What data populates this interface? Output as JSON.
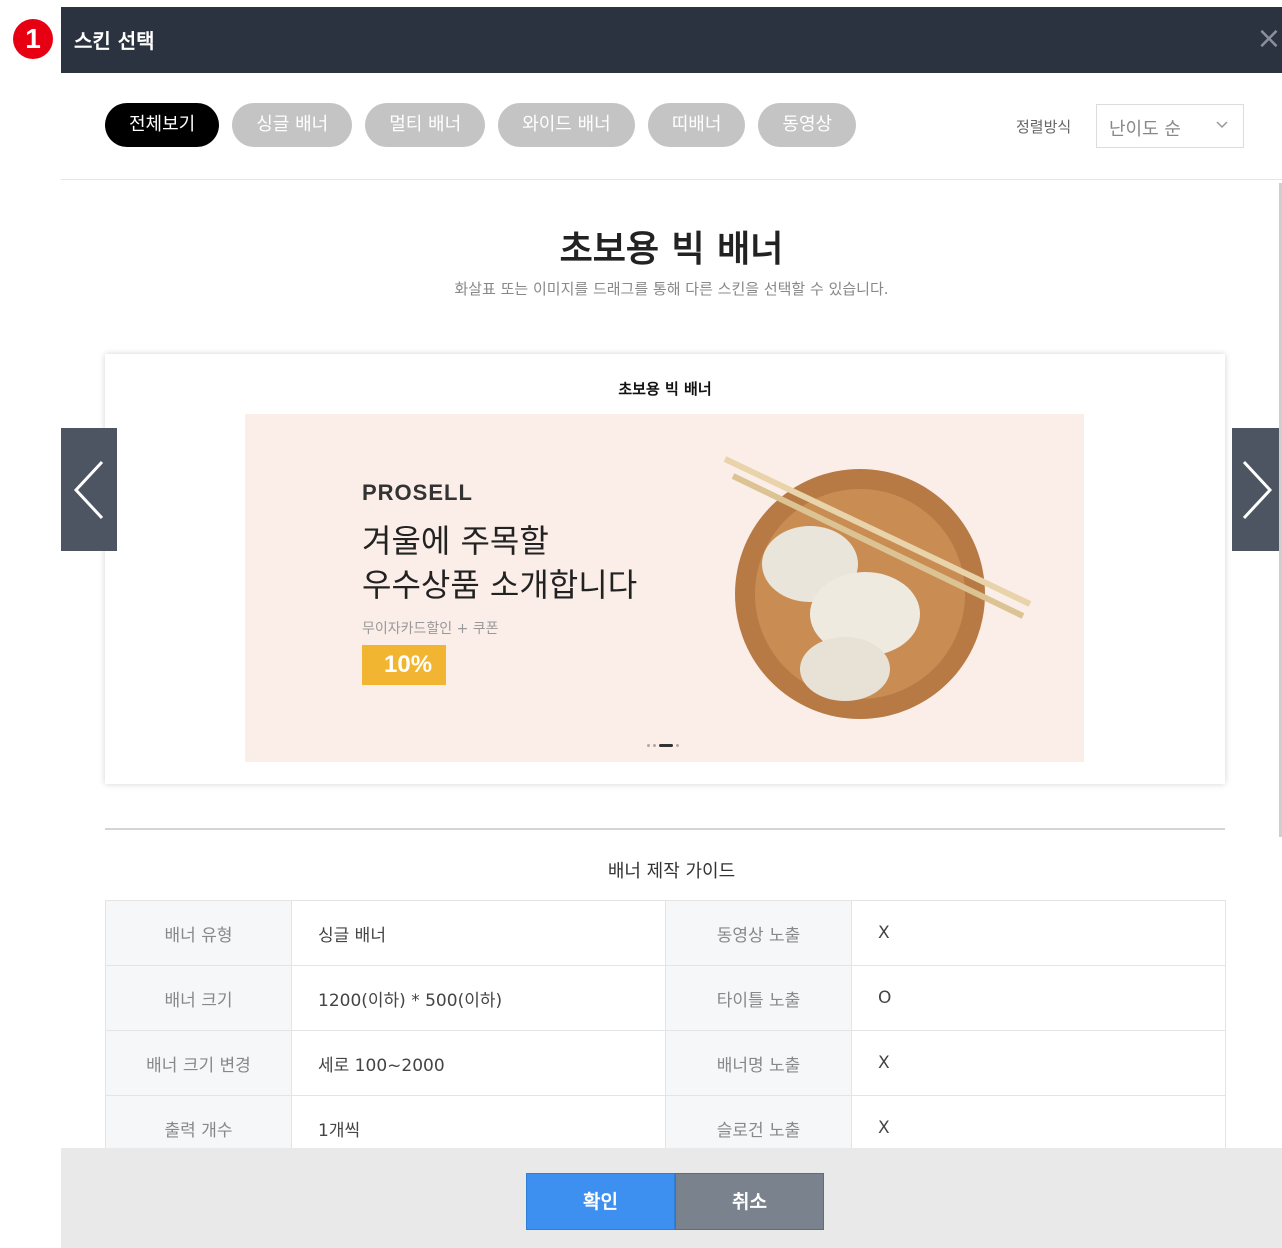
{
  "badge": "1",
  "modal": {
    "title": "스킨 선택",
    "close_symbol": "×"
  },
  "filters": {
    "tabs": [
      "전체보기",
      "싱글 배너",
      "멀티 배너",
      "와이드 배너",
      "띠배너",
      "동영상"
    ],
    "active_tab": "전체보기",
    "sort_label": "정렬방식",
    "sort_value": "난이도 순"
  },
  "skin": {
    "title": "초보용 빅 배너",
    "description": "화살표 또는 이미지를 드래그를 통해 다른 스킨을 선택할 수 있습니다.",
    "preview_title": "초보용 빅 배너"
  },
  "banner": {
    "brand": "PROSELL",
    "headline_line1": "겨울에 주목할",
    "headline_line2": "우수상품 소개합니다",
    "subtext": "무이자카드할인 + 쿠폰",
    "discount": "10%",
    "page_count": 4,
    "current_page": 3
  },
  "guide": {
    "title": "배너 제작 가이드",
    "rows": [
      {
        "label": "배너 유형",
        "value": "싱글 배너",
        "label2": "동영상 노출",
        "value2": "X"
      },
      {
        "label": "배너 크기",
        "value": "1200(이하) * 500(이하)",
        "label2": "타이틀 노출",
        "value2": "O"
      },
      {
        "label": "배너 크기 변경",
        "value": "세로 100~2000",
        "label2": "배너명 노출",
        "value2": "X"
      },
      {
        "label": "출력 개수",
        "value": "1개씩",
        "label2": "슬로건 노출",
        "value2": "X"
      }
    ]
  },
  "footer": {
    "confirm": "확인",
    "cancel": "취소"
  },
  "colors": {
    "header": "#2b3240",
    "confirm": "#3d8ff0",
    "cancel": "#7a828d",
    "badge": "#e60012",
    "discount": "#f2b531"
  }
}
